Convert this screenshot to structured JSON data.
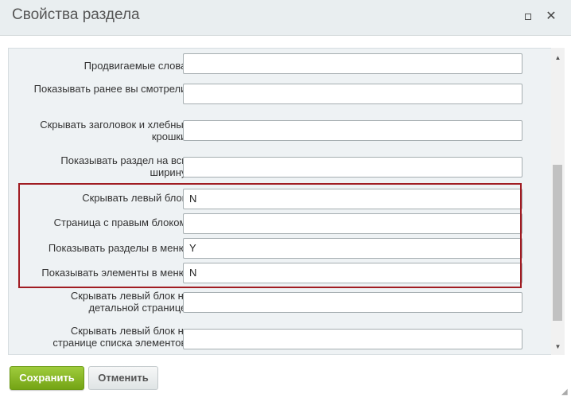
{
  "dialog": {
    "title": "Свойства раздела",
    "maximize_icon": "maximize-icon",
    "close_icon": "close-icon"
  },
  "fields": [
    {
      "label": "Продвигаемые слова:",
      "value": ""
    },
    {
      "label": "Показывать ранее вы смотрели:",
      "value": ""
    },
    {
      "label": "Скрывать заголовок и хлебные крошки:",
      "value": ""
    },
    {
      "label": "Показывать раздел на всю ширину:",
      "value": ""
    },
    {
      "label": "Скрывать левый блок:",
      "value": "N"
    },
    {
      "label": "Страница с правым блоком:",
      "value": ""
    },
    {
      "label": "Показывать разделы в меню:",
      "value": "Y"
    },
    {
      "label": "Показывать элементы в меню:",
      "value": "N"
    },
    {
      "label": "Скрывать левый блок на детальной странице:",
      "value": ""
    },
    {
      "label": "Скрывать левый блок на странице списка элементов:",
      "value": ""
    }
  ],
  "footer": {
    "save_label": "Сохранить",
    "cancel_label": "Отменить"
  },
  "colors": {
    "highlight_border": "#a01c22",
    "save_green": "#7cb01b"
  }
}
